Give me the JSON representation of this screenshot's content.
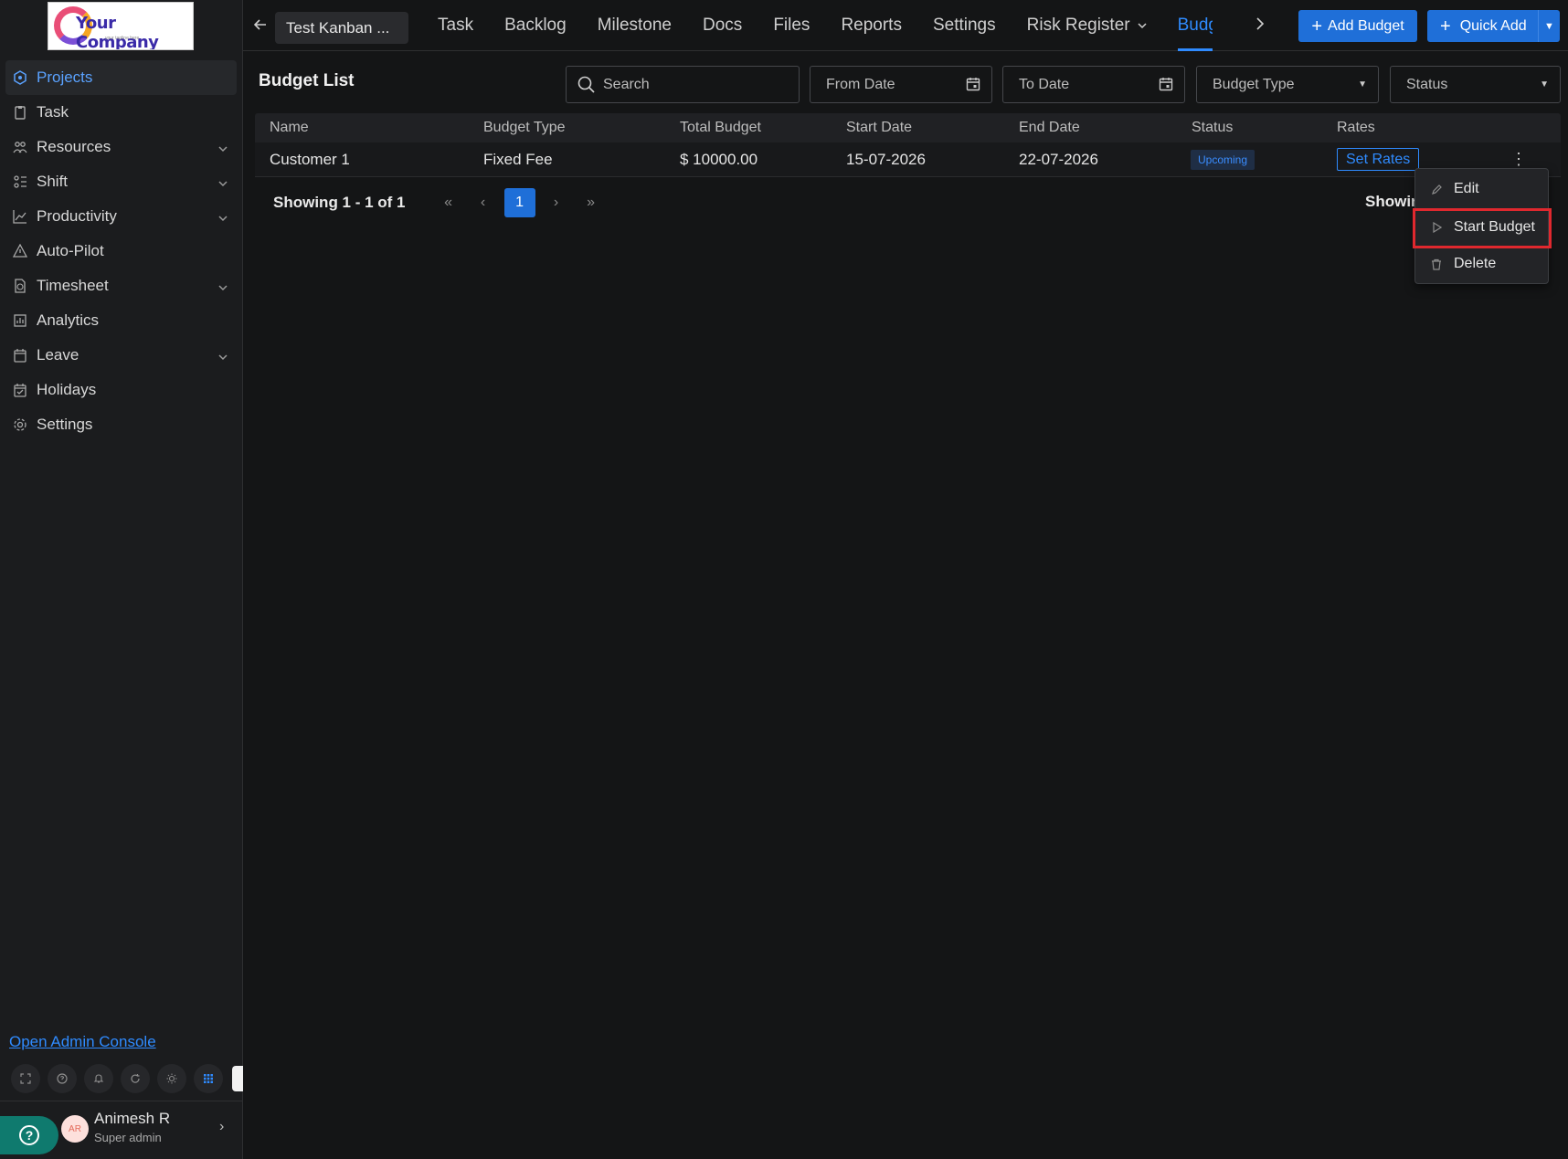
{
  "sidebar": {
    "logo_text": "Your Company",
    "logo_tagline": "your tagline here",
    "items": [
      {
        "label": "Projects",
        "icon": "projects-icon",
        "active": true
      },
      {
        "label": "Task",
        "icon": "task-icon"
      },
      {
        "label": "Resources",
        "icon": "resources-icon",
        "expandable": true
      },
      {
        "label": "Shift",
        "icon": "shift-icon",
        "expandable": true
      },
      {
        "label": "Productivity",
        "icon": "productivity-icon",
        "expandable": true
      },
      {
        "label": "Auto-Pilot",
        "icon": "auto-pilot-icon"
      },
      {
        "label": "Timesheet",
        "icon": "timesheet-icon",
        "expandable": true
      },
      {
        "label": "Analytics",
        "icon": "analytics-icon"
      },
      {
        "label": "Leave",
        "icon": "leave-icon",
        "expandable": true
      },
      {
        "label": "Holidays",
        "icon": "holidays-icon"
      },
      {
        "label": "Settings",
        "icon": "settings-icon"
      }
    ],
    "admin_link": "Open Admin Console",
    "user": {
      "initials": "AR",
      "name": "Animesh R",
      "role": "Super admin"
    }
  },
  "topbar": {
    "project_name": "Test Kanban ...",
    "tabs": [
      "Task",
      "Backlog",
      "Milestone",
      "Docs",
      "Files",
      "Reports",
      "Settings",
      "Risk Register",
      "Budget"
    ],
    "active_tab": "Budget",
    "add_budget_label": "Add Budget",
    "quick_add_label": "Quick Add"
  },
  "main": {
    "title": "Budget List",
    "filters": {
      "search_placeholder": "Search",
      "from_date_placeholder": "From Date",
      "to_date_placeholder": "To Date",
      "budget_type_placeholder": "Budget Type",
      "status_placeholder": "Status"
    },
    "table": {
      "headers": [
        "Name",
        "Budget Type",
        "Total Budget",
        "Start Date",
        "End Date",
        "Status",
        "Rates"
      ],
      "rows": [
        {
          "name": "Customer 1",
          "budget_type": "Fixed Fee",
          "total_budget": "$ 10000.00",
          "start_date": "15-07-2026",
          "end_date": "22-07-2026",
          "status": "Upcoming",
          "rates_button": "Set Rates"
        }
      ]
    },
    "pagination": {
      "summary": "Showing 1 - 1 of 1",
      "current_page": "1",
      "right_text": "Showing"
    },
    "row_menu": {
      "edit": "Edit",
      "start_budget": "Start Budget",
      "delete": "Delete"
    }
  },
  "colors": {
    "accent": "#1f6fd8",
    "link": "#2f8bff",
    "highlight": "#e0282e",
    "background": "#141516"
  }
}
